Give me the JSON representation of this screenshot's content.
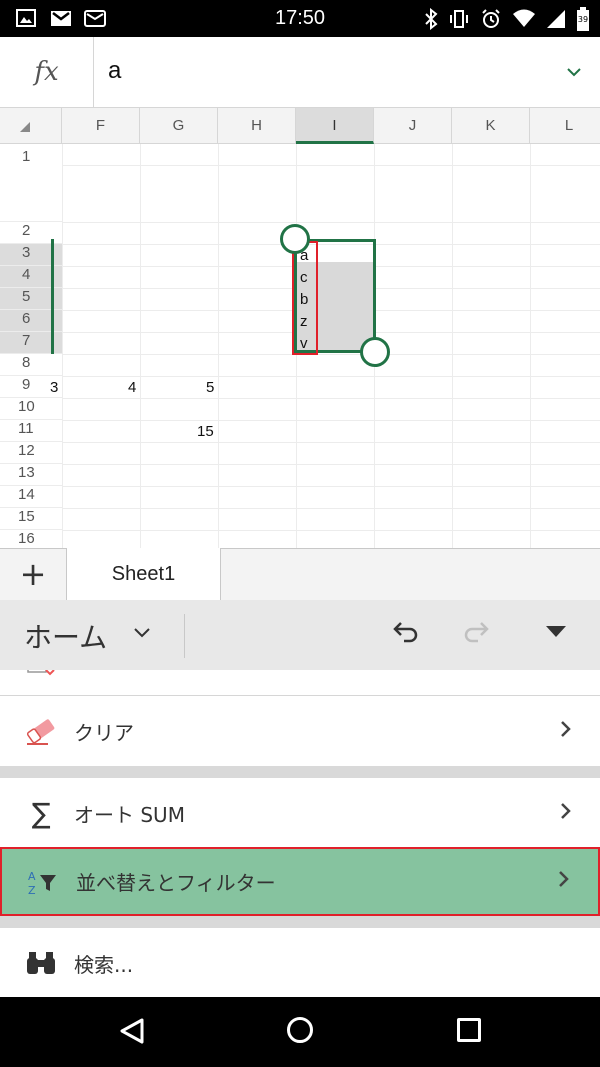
{
  "status_bar": {
    "time": "17:50",
    "battery": "39"
  },
  "formula_bar": {
    "fx_label": "fx",
    "value": "a"
  },
  "columns": [
    "F",
    "G",
    "H",
    "I",
    "J",
    "K",
    "L"
  ],
  "rows": [
    "1",
    "2",
    "3",
    "4",
    "5",
    "6",
    "7",
    "8",
    "9",
    "10",
    "11",
    "12",
    "13",
    "14",
    "15",
    "16"
  ],
  "cells": {
    "e9": "3",
    "f9": "4",
    "g9": "5",
    "g11": "15",
    "i3": "a",
    "i4": "c",
    "i5": "b",
    "i6": "z",
    "i7": "v"
  },
  "sheets": {
    "add": "+",
    "active": "Sheet1"
  },
  "ribbon": {
    "tab_label": "ホーム"
  },
  "menu": {
    "clear": "クリア",
    "autosum": "オート SUM",
    "sort_filter": "並べ替えとフィルター",
    "find": "検索..."
  },
  "colors": {
    "accent": "#217346",
    "highlight": "#86c39f",
    "annotation": "#e0202a"
  }
}
